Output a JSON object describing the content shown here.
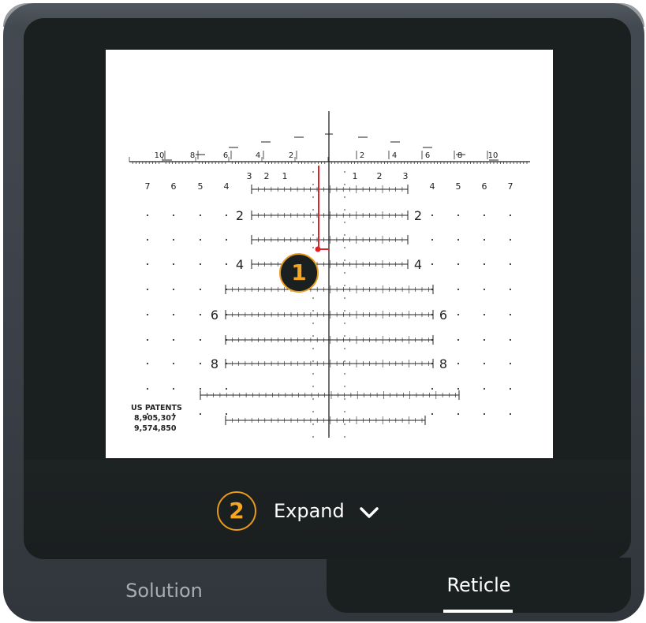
{
  "reticle": {
    "patent_title": "US PATENTS",
    "patent_1": "8,905,307",
    "patent_2": "9,574,850",
    "top_scale": [
      "10",
      "8",
      "6",
      "4",
      "2",
      "2",
      "4",
      "6",
      "8",
      "10"
    ],
    "second_scale_left": [
      "7",
      "6",
      "5",
      "4",
      "3",
      "2",
      "1"
    ],
    "second_scale_right": [
      "1",
      "2",
      "3",
      "4",
      "5",
      "6",
      "7"
    ],
    "row_labels": [
      "2",
      "4",
      "6",
      "8"
    ],
    "marker_color": "#e0232b",
    "badge_color": "#f5a623"
  },
  "callout_1": "1",
  "expand": {
    "badge": "2",
    "label": "Expand",
    "icon": "chevron-down-icon"
  },
  "tabs": {
    "solution": "Solution",
    "reticle": "Reticle",
    "active": "Reticle"
  }
}
